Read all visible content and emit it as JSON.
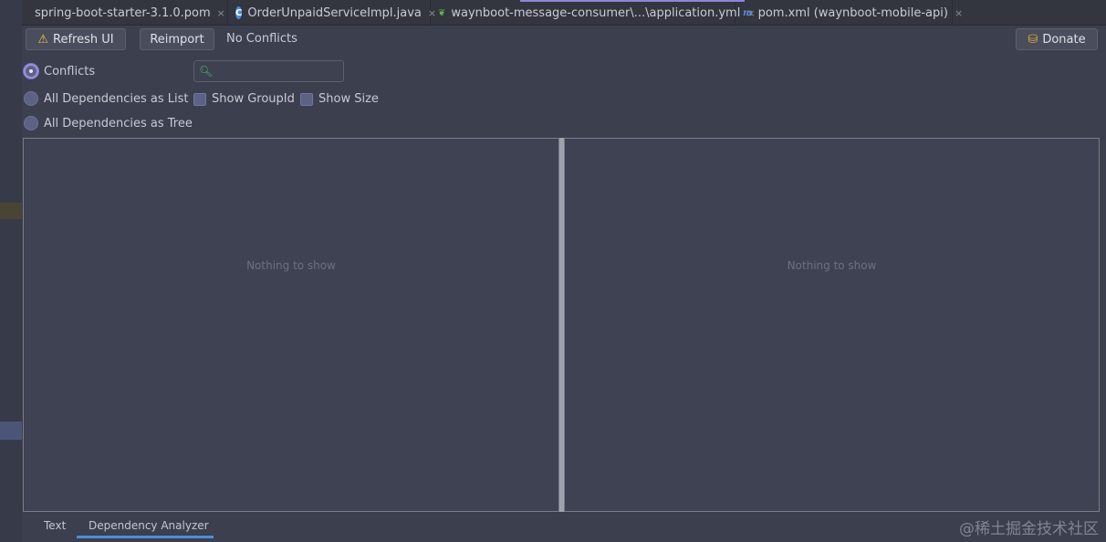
{
  "tabs": [
    {
      "label": "spring-boot-starter-3.1.0.pom",
      "icon": "pom-file-icon",
      "close": "×"
    },
    {
      "label": "OrderUnpaidServiceImpl.java",
      "icon": "class-c-icon",
      "icon_glyph": "C",
      "close": "×"
    },
    {
      "label": "waynboot-message-consumer\\...\\application.yml",
      "icon": "spring-yml-icon",
      "icon_glyph": "❦",
      "close": "×"
    },
    {
      "label": "pom.xml (waynboot-mobile-api)",
      "icon": "maven-m-icon",
      "icon_glyph": "m",
      "close": "×"
    }
  ],
  "toolbar": {
    "refresh_label": "Refresh UI",
    "refresh_icon": "warning-icon",
    "reimport_label": "Reimport",
    "status": "No Conflicts",
    "donate_label": "Donate",
    "donate_icon": "donate-coin-icon"
  },
  "options": {
    "conflicts": "Conflicts",
    "as_list": "All Dependencies as List",
    "as_tree": "All Dependencies as Tree",
    "selected": "Conflicts",
    "show_groupid": "Show GroupId",
    "show_size": "Show Size"
  },
  "search": {
    "value": "",
    "placeholder": ""
  },
  "panels": {
    "left_empty": "Nothing to show",
    "right_empty": "Nothing to show"
  },
  "bottom_tabs": {
    "text": "Text",
    "analyzer": "Dependency Analyzer",
    "active": "Dependency Analyzer"
  },
  "watermark": "@稀土掘金技术社区",
  "colors": {
    "background": "#3c3f4e",
    "panel": "#3f4253",
    "accent": "#4a90d9",
    "warning": "#e9c14a"
  }
}
